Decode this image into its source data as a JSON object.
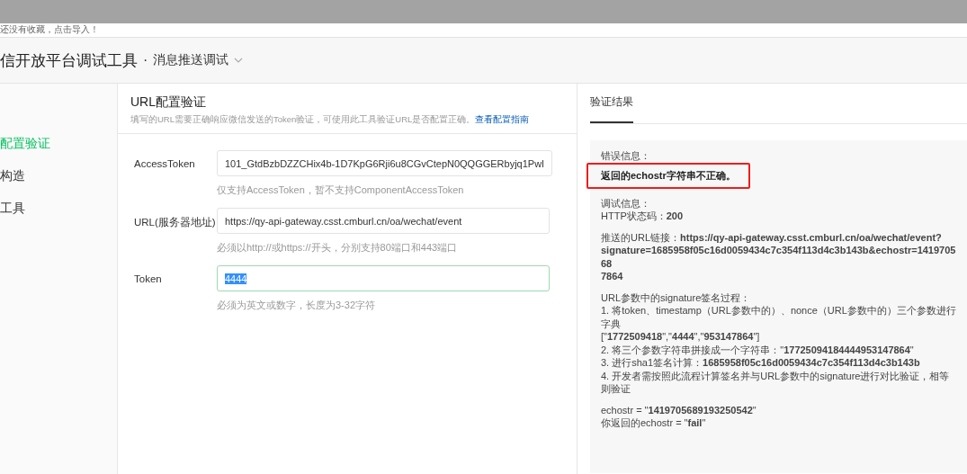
{
  "notice": "还没有收藏，点击导入！",
  "header": {
    "title": "信开放平台调试工具",
    "separator": "·",
    "subtitle": "消息推送调试"
  },
  "sidebar": {
    "items": [
      {
        "label": "配置验证",
        "selected": true
      },
      {
        "label": "构造",
        "selected": false
      },
      {
        "label": "工具",
        "selected": false
      }
    ]
  },
  "config": {
    "title": "URL配置验证",
    "description": "填写的URL需要正确响应微信发送的Token验证，可使用此工具验证URL是否配置正确。",
    "guide_link": "查看配置指南",
    "fields": [
      {
        "label": "AccessToken",
        "value": "101_GtdBzbDZZCHix4b-1D7KpG6Rji6u8CGvCtepN0QQGGERbyjq1Pwl",
        "hint": "仅支持AccessToken，暂不支持ComponentAccessToken",
        "focused": false
      },
      {
        "label": "URL(服务器地址)",
        "value": "https://qy-api-gateway.csst.cmburl.cn/oa/wechat/event",
        "hint": "必须以http://或https://开头，分别支持80端口和443端口",
        "focused": false
      },
      {
        "label": "Token",
        "value": "4444",
        "hint": "必须为英文或数字，长度为3-32字符",
        "focused": true
      }
    ]
  },
  "result": {
    "tabs": [
      {
        "label": "验证结果",
        "selected": true
      }
    ],
    "error": {
      "label": "错误信息：",
      "message": "返回的echostr字符串不正确。",
      "highlighted": true
    },
    "paragraphs": [
      [
        "调试信息：",
        "HTTP状态码：**200**"
      ],
      [
        "推送的URL链接：**https://qy-api-gateway.csst.cmburl.cn/oa/wechat/event?**",
        "**signature=1685958f05c16d0059434c7c354f113d4c3b143b&echostr=141970568**",
        "**7864**"
      ],
      [
        "URL参数中的signature签名过程：",
        "1. 将token、timestamp（URL参数中的）、nonce（URL参数中的）三个参数进行字典",
        "[\"**1772509418**\",\"**4444**\",\"**953147864**\"]",
        "2. 将三个参数字符串拼接成一个字符串：\"**17725094184444953147864**\"",
        "3. 进行sha1签名计算：**1685958f05c16d0059434c7c354f113d4c3b143b**",
        "4. 开发者需按照此流程计算签名并与URL参数中的signature进行对比验证，相等则验证"
      ],
      [
        "echostr = \"**1419705689193250542**\"",
        "你返回的echostr = \"**fail**\""
      ]
    ]
  }
}
